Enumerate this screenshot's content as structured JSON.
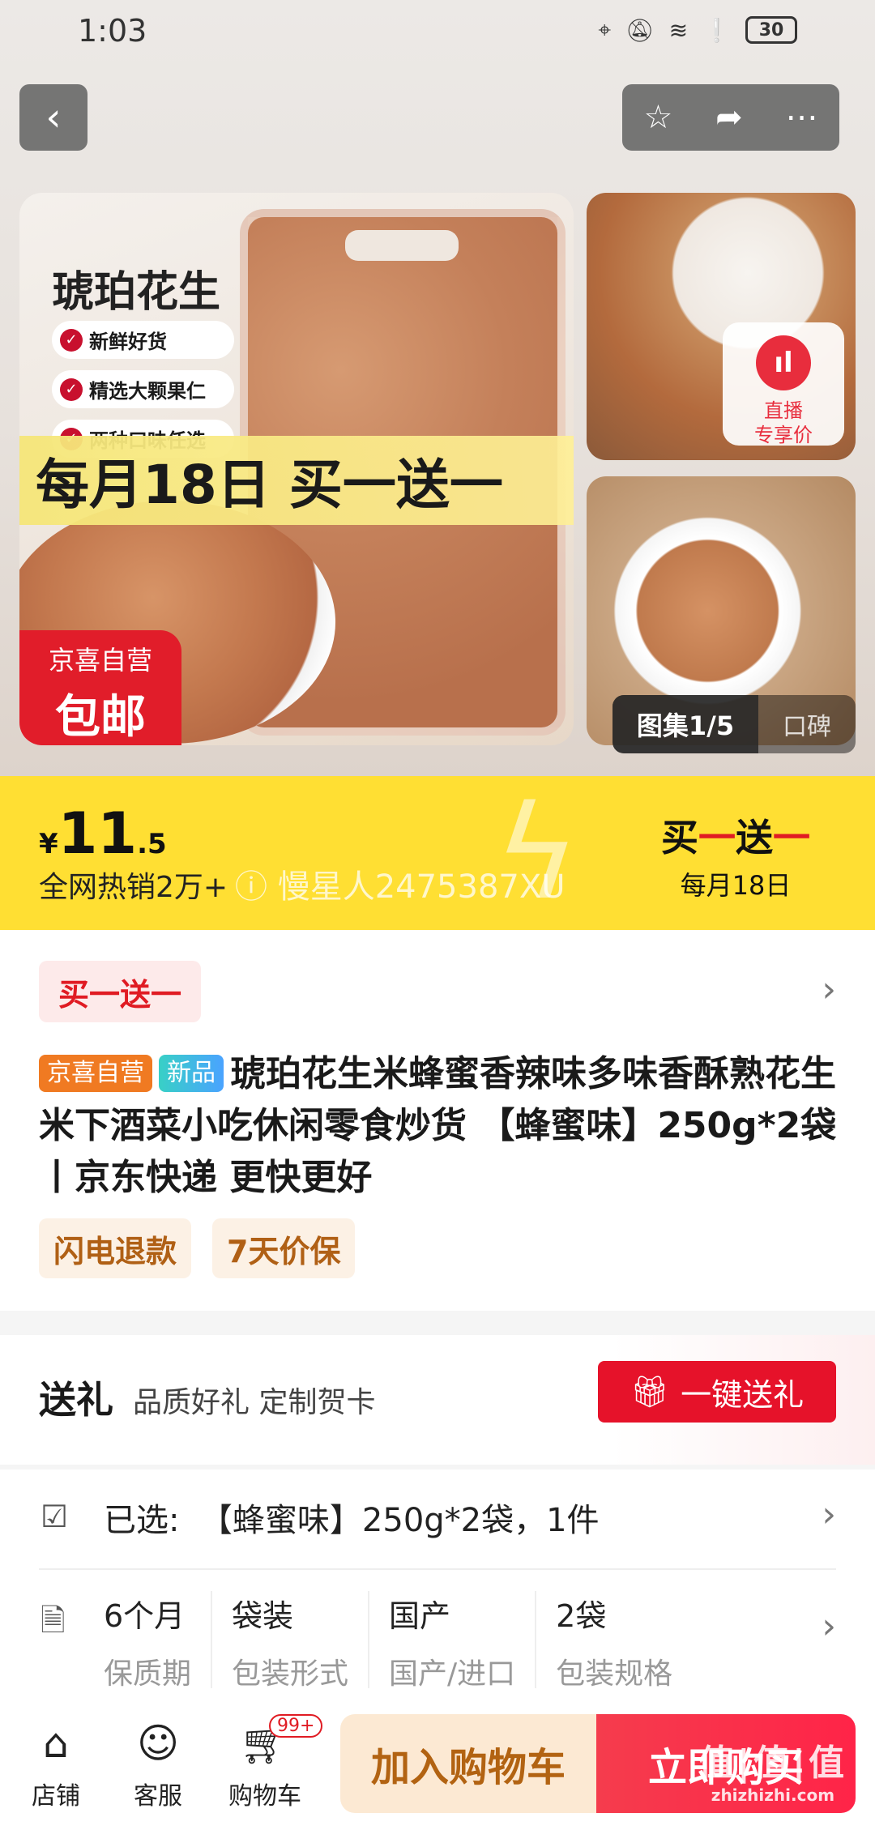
{
  "status": {
    "time": "1:03",
    "battery": "30"
  },
  "nav": {
    "back_icon": "chevron-left-icon",
    "favorite_icon": "star-icon",
    "share_icon": "share-icon",
    "more_icon": "more-icon"
  },
  "hero": {
    "title": "琥珀花生",
    "tags": [
      "新鲜好货",
      "精选大颗果仁",
      "两种口味任选"
    ],
    "promo": "每月18日 买一送一",
    "badge_line1": "京喜自营",
    "badge_line2": "包邮",
    "live_label_1": "直播",
    "live_label_2": "专享价",
    "gallery_label": "图集1/5",
    "reviews_label": "口碑"
  },
  "price": {
    "currency": "¥",
    "integer": "11",
    "decimal": ".5",
    "sold": "全网热销2万+",
    "watermark": "ⓘ 慢星人2475387XU",
    "bogo_a": "买",
    "bogo_dash1": "一",
    "bogo_b": "送",
    "bogo_dash2": "一",
    "bogo_date": "每月18日"
  },
  "product": {
    "promo_chip": "买一送一",
    "self_tag": "京喜自营",
    "new_tag": "新品",
    "title": "琥珀花生米蜂蜜香辣味多味香酥熟花生米下酒菜小吃休闲零食炒货 【蜂蜜味】250g*2袋丨京东快递 更快更好",
    "service_1": "闪电退款",
    "service_2": "7天价保"
  },
  "gift": {
    "heading": "送礼",
    "sub": "品质好礼 定制贺卡",
    "button": "一键送礼"
  },
  "spec": {
    "selected_label": "已选:",
    "selected_value": "【蜂蜜味】250g*2袋，1件",
    "items": [
      {
        "value": "6个月",
        "key": "保质期"
      },
      {
        "value": "袋装",
        "key": "包装形式"
      },
      {
        "value": "国产",
        "key": "国产/进口"
      },
      {
        "value": "2袋",
        "key": "包装规格"
      }
    ]
  },
  "bottom": {
    "shop": "店铺",
    "service": "客服",
    "cart": "购物车",
    "cart_badge": "99+",
    "add_cart": "加入购物车",
    "buy_now": "立即购买",
    "watermark_big": "值|值|值",
    "watermark_small": "zhizhizhi.com"
  },
  "colors": {
    "accent_red": "#e6122a",
    "price_band": "#ffdf33",
    "cart_btn": "#fce9d3"
  }
}
